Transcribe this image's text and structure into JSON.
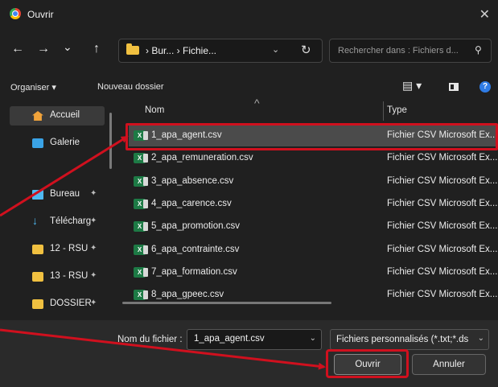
{
  "window": {
    "title": "Ouvrir",
    "close_glyph": "✕"
  },
  "nav": {
    "back": "←",
    "forward": "→",
    "recent": "⌄",
    "up": "↑",
    "path": "› Bur...  › Fichie...",
    "path_dropdown": "⌄",
    "refresh": "↻",
    "search_placeholder": "Rechercher dans : Fichiers d...",
    "search_icon": "⚲"
  },
  "toolbar": {
    "organize": "Organiser ▾",
    "new_folder": "Nouveau dossier",
    "view": "▤ ▾",
    "help": "?"
  },
  "sidebar": {
    "items": [
      {
        "label": "Accueil",
        "icon": "home-icon",
        "pinned": false,
        "selected": true
      },
      {
        "label": "Galerie",
        "icon": "gallery-icon",
        "pinned": false,
        "selected": false
      },
      {
        "label": "Bureau",
        "icon": "desktop-icon",
        "pinned": true,
        "selected": false
      },
      {
        "label": "Télécharg",
        "icon": "download-icon",
        "pinned": true,
        "selected": false
      },
      {
        "label": "12 - RSU",
        "icon": "folder-icon",
        "pinned": true,
        "selected": false
      },
      {
        "label": "13 - RSU",
        "icon": "folder-icon",
        "pinned": true,
        "selected": false
      },
      {
        "label": "DOSSIER",
        "icon": "folder-icon",
        "pinned": true,
        "selected": false
      }
    ],
    "pin_glyph": "✦",
    "download_glyph": "↓"
  },
  "columns": {
    "name": "Nom",
    "type": "Type",
    "sort_glyph": "^"
  },
  "files": [
    {
      "name": "1_apa_agent.csv",
      "type": "Fichier CSV Microsoft Ex...",
      "selected": true
    },
    {
      "name": "2_apa_remuneration.csv",
      "type": "Fichier CSV Microsoft Ex...",
      "selected": false
    },
    {
      "name": "3_apa_absence.csv",
      "type": "Fichier CSV Microsoft Ex...",
      "selected": false
    },
    {
      "name": "4_apa_carence.csv",
      "type": "Fichier CSV Microsoft Ex...",
      "selected": false
    },
    {
      "name": "5_apa_promotion.csv",
      "type": "Fichier CSV Microsoft Ex...",
      "selected": false
    },
    {
      "name": "6_apa_contrainte.csv",
      "type": "Fichier CSV Microsoft Ex...",
      "selected": false
    },
    {
      "name": "7_apa_formation.csv",
      "type": "Fichier CSV Microsoft Ex...",
      "selected": false
    },
    {
      "name": "8_apa_gpeec.csv",
      "type": "Fichier CSV Microsoft Ex...",
      "selected": false
    }
  ],
  "file_icon_text": "X",
  "bottom": {
    "filename_label": "Nom du fichier :",
    "filename_value": "1_apa_agent.csv",
    "dropdown_glyph": "⌄",
    "filter": "Fichiers personnalisés (*.txt;*.ds",
    "open": "Ouvrir",
    "cancel": "Annuler"
  },
  "colors": {
    "dialog_bg": "#202020",
    "selection": "#4b4b4b",
    "highlight": "#d0101e"
  }
}
